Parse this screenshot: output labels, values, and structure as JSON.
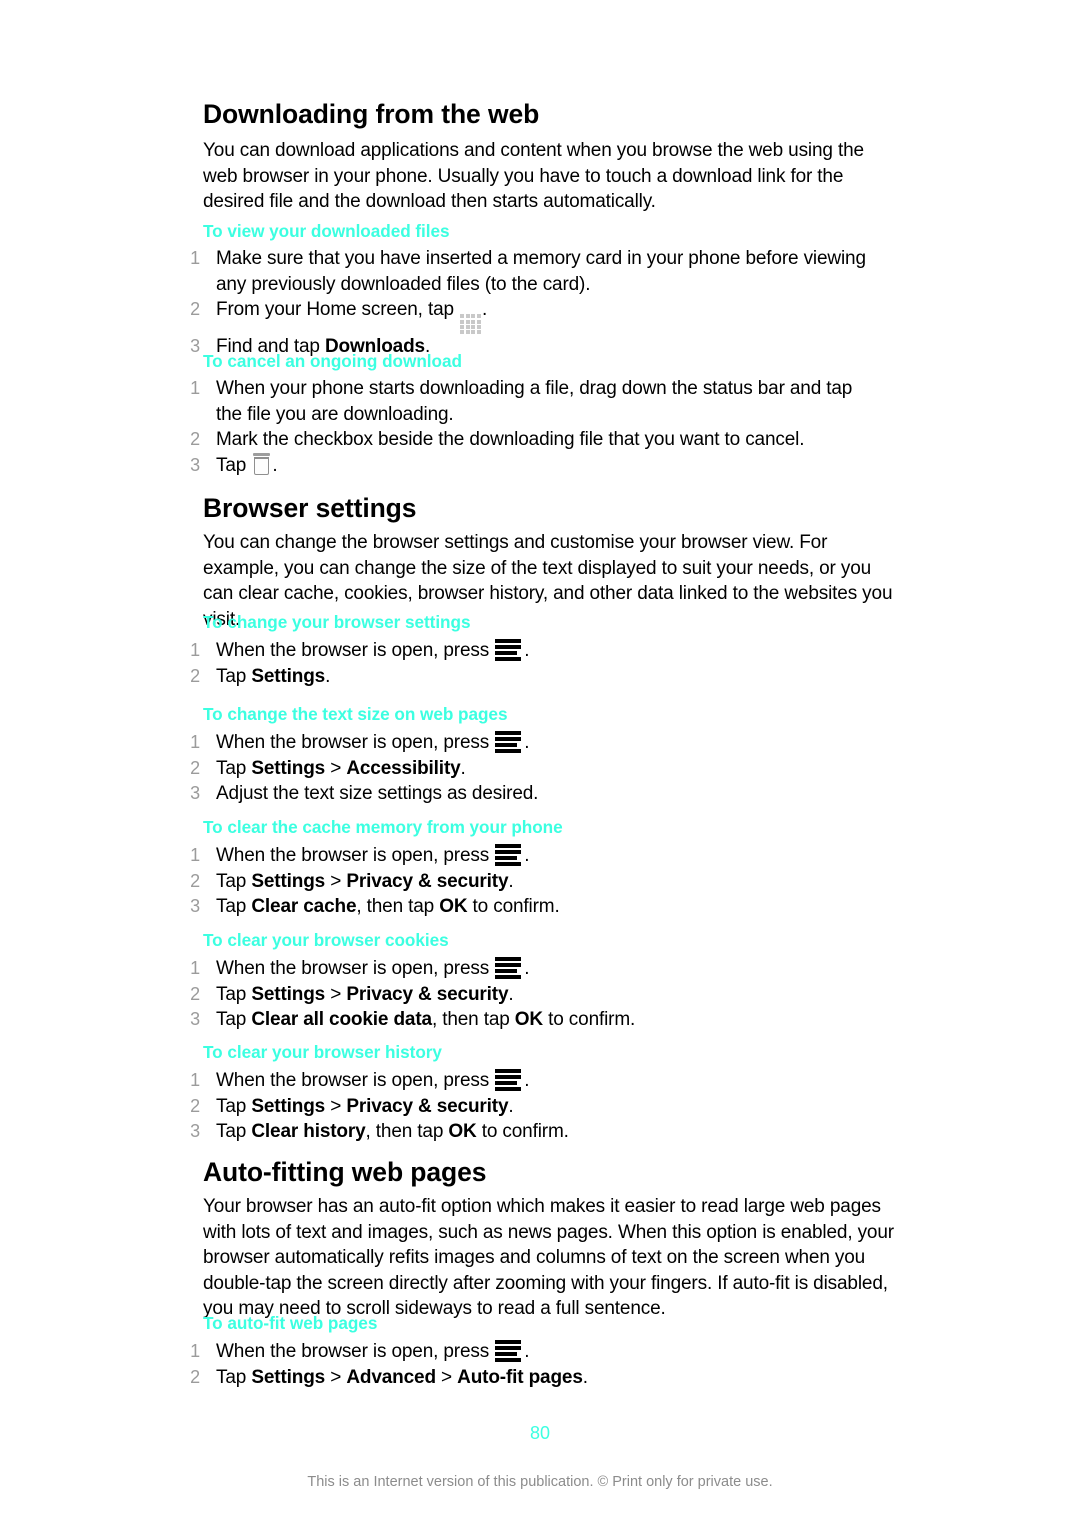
{
  "document": {
    "page_number": "80",
    "footer_note": "This is an Internet version of this publication. © Print only for private use.",
    "accent_color": "#3cffe1",
    "number_color": "#9b9b9b"
  },
  "sections": [
    {
      "title": "Downloading from the web",
      "paragraph": "You can download applications and content when you browse the web using the web browser in your phone. Usually you have to touch a download link for the desired file and the download then starts automatically.",
      "procedures": [
        {
          "heading": "To view your downloaded files",
          "steps": [
            {
              "num": "1",
              "parts": [
                {
                  "t": "text",
                  "v": "Make sure that you have inserted a memory card in your phone before viewing any previously downloaded files (to the card)."
                }
              ]
            },
            {
              "num": "2",
              "parts": [
                {
                  "t": "text",
                  "v": "From your Home screen, tap "
                },
                {
                  "t": "icon",
                  "v": "app-grid-icon"
                },
                {
                  "t": "text",
                  "v": "."
                }
              ]
            },
            {
              "num": "3",
              "parts": [
                {
                  "t": "text",
                  "v": "Find and tap "
                },
                {
                  "t": "bold",
                  "v": "Downloads"
                },
                {
                  "t": "text",
                  "v": "."
                }
              ]
            }
          ]
        },
        {
          "heading": "To cancel an ongoing download",
          "steps": [
            {
              "num": "1",
              "parts": [
                {
                  "t": "text",
                  "v": "When your phone starts downloading a file, drag down the status bar and tap the file you are downloading."
                }
              ]
            },
            {
              "num": "2",
              "parts": [
                {
                  "t": "text",
                  "v": "Mark the checkbox beside the downloading file that you want to cancel."
                }
              ]
            },
            {
              "num": "3",
              "parts": [
                {
                  "t": "text",
                  "v": "Tap "
                },
                {
                  "t": "icon",
                  "v": "trash-icon"
                },
                {
                  "t": "text",
                  "v": "."
                }
              ]
            }
          ]
        }
      ]
    },
    {
      "title": "Browser settings",
      "paragraph": "You can change the browser settings and customise your browser view. For example, you can change the size of the text displayed to suit your needs, or you can clear cache, cookies, browser history, and other data linked to the websites you visit.",
      "procedures": [
        {
          "heading": "To change your browser settings",
          "steps": [
            {
              "num": "1",
              "parts": [
                {
                  "t": "text",
                  "v": "When the browser is open, press "
                },
                {
                  "t": "icon",
                  "v": "menu-icon"
                },
                {
                  "t": "text",
                  "v": "."
                }
              ]
            },
            {
              "num": "2",
              "parts": [
                {
                  "t": "text",
                  "v": "Tap "
                },
                {
                  "t": "bold",
                  "v": "Settings"
                },
                {
                  "t": "text",
                  "v": "."
                }
              ]
            }
          ]
        },
        {
          "heading": "To change the text size on web pages",
          "steps": [
            {
              "num": "1",
              "parts": [
                {
                  "t": "text",
                  "v": "When the browser is open, press "
                },
                {
                  "t": "icon",
                  "v": "menu-icon"
                },
                {
                  "t": "text",
                  "v": "."
                }
              ]
            },
            {
              "num": "2",
              "parts": [
                {
                  "t": "text",
                  "v": "Tap "
                },
                {
                  "t": "bold",
                  "v": "Settings"
                },
                {
                  "t": "text",
                  "v": " > "
                },
                {
                  "t": "bold",
                  "v": "Accessibility"
                },
                {
                  "t": "text",
                  "v": "."
                }
              ]
            },
            {
              "num": "3",
              "parts": [
                {
                  "t": "text",
                  "v": "Adjust the text size settings as desired."
                }
              ]
            }
          ]
        },
        {
          "heading": "To clear the cache memory from your phone",
          "steps": [
            {
              "num": "1",
              "parts": [
                {
                  "t": "text",
                  "v": "When the browser is open, press "
                },
                {
                  "t": "icon",
                  "v": "menu-icon"
                },
                {
                  "t": "text",
                  "v": "."
                }
              ]
            },
            {
              "num": "2",
              "parts": [
                {
                  "t": "text",
                  "v": "Tap "
                },
                {
                  "t": "bold",
                  "v": "Settings"
                },
                {
                  "t": "text",
                  "v": " > "
                },
                {
                  "t": "bold",
                  "v": "Privacy & security"
                },
                {
                  "t": "text",
                  "v": "."
                }
              ]
            },
            {
              "num": "3",
              "parts": [
                {
                  "t": "text",
                  "v": "Tap "
                },
                {
                  "t": "bold",
                  "v": "Clear cache"
                },
                {
                  "t": "text",
                  "v": ", then tap "
                },
                {
                  "t": "bold",
                  "v": "OK"
                },
                {
                  "t": "text",
                  "v": " to confirm."
                }
              ]
            }
          ]
        },
        {
          "heading": "To clear your browser cookies",
          "steps": [
            {
              "num": "1",
              "parts": [
                {
                  "t": "text",
                  "v": "When the browser is open, press "
                },
                {
                  "t": "icon",
                  "v": "menu-icon"
                },
                {
                  "t": "text",
                  "v": "."
                }
              ]
            },
            {
              "num": "2",
              "parts": [
                {
                  "t": "text",
                  "v": "Tap "
                },
                {
                  "t": "bold",
                  "v": "Settings"
                },
                {
                  "t": "text",
                  "v": " > "
                },
                {
                  "t": "bold",
                  "v": "Privacy & security"
                },
                {
                  "t": "text",
                  "v": "."
                }
              ]
            },
            {
              "num": "3",
              "parts": [
                {
                  "t": "text",
                  "v": "Tap "
                },
                {
                  "t": "bold",
                  "v": "Clear all cookie data"
                },
                {
                  "t": "text",
                  "v": ", then tap "
                },
                {
                  "t": "bold",
                  "v": "OK"
                },
                {
                  "t": "text",
                  "v": " to confirm."
                }
              ]
            }
          ]
        },
        {
          "heading": "To clear your browser history",
          "steps": [
            {
              "num": "1",
              "parts": [
                {
                  "t": "text",
                  "v": "When the browser is open, press "
                },
                {
                  "t": "icon",
                  "v": "menu-icon"
                },
                {
                  "t": "text",
                  "v": "."
                }
              ]
            },
            {
              "num": "2",
              "parts": [
                {
                  "t": "text",
                  "v": "Tap "
                },
                {
                  "t": "bold",
                  "v": "Settings"
                },
                {
                  "t": "text",
                  "v": " > "
                },
                {
                  "t": "bold",
                  "v": "Privacy & security"
                },
                {
                  "t": "text",
                  "v": "."
                }
              ]
            },
            {
              "num": "3",
              "parts": [
                {
                  "t": "text",
                  "v": "Tap "
                },
                {
                  "t": "bold",
                  "v": "Clear history"
                },
                {
                  "t": "text",
                  "v": ", then tap "
                },
                {
                  "t": "bold",
                  "v": "OK"
                },
                {
                  "t": "text",
                  "v": " to confirm."
                }
              ]
            }
          ]
        }
      ]
    },
    {
      "title": "Auto-fitting web pages",
      "paragraph": "Your browser has an auto-fit option which makes it easier to read large web pages with lots of text and images, such as news pages. When this option is enabled, your browser automatically refits images and columns of text on the screen when you double-tap the screen directly after zooming with your fingers. If auto-fit is disabled, you may need to scroll sideways to read a full sentence.",
      "procedures": [
        {
          "heading": "To auto-fit web pages",
          "steps": [
            {
              "num": "1",
              "parts": [
                {
                  "t": "text",
                  "v": "When the browser is open, press "
                },
                {
                  "t": "icon",
                  "v": "menu-icon"
                },
                {
                  "t": "text",
                  "v": "."
                }
              ]
            },
            {
              "num": "2",
              "parts": [
                {
                  "t": "text",
                  "v": "Tap "
                },
                {
                  "t": "bold",
                  "v": "Settings"
                },
                {
                  "t": "text",
                  "v": " > "
                },
                {
                  "t": "bold",
                  "v": "Advanced"
                },
                {
                  "t": "text",
                  "v": " > "
                },
                {
                  "t": "bold",
                  "v": "Auto-fit pages"
                },
                {
                  "t": "text",
                  "v": "."
                }
              ]
            }
          ]
        }
      ]
    }
  ]
}
